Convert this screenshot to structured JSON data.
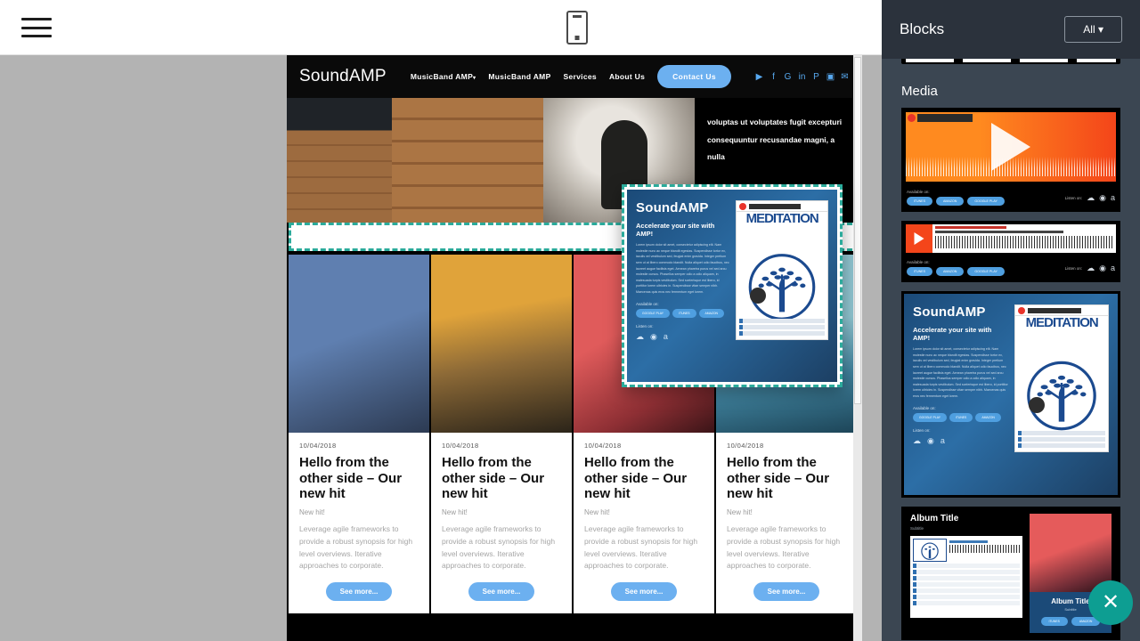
{
  "toolbar": {
    "menu_icon": "hamburger-menu-icon",
    "device_icon": "mobile-preview-icon"
  },
  "site": {
    "brand": "SoundAMP",
    "nav": [
      {
        "label": "MusicBand AMP",
        "has_caret": true
      },
      {
        "label": "MusicBand AMP",
        "has_caret": false
      },
      {
        "label": "Services",
        "has_caret": false
      },
      {
        "label": "About Us",
        "has_caret": false
      }
    ],
    "contact_label": "Contact Us",
    "socials": [
      {
        "name": "youtube-icon",
        "glyph": "▶"
      },
      {
        "name": "facebook-icon",
        "glyph": "f"
      },
      {
        "name": "google-plus-icon",
        "glyph": "G"
      },
      {
        "name": "linkedin-icon",
        "glyph": "in"
      },
      {
        "name": "pinterest-icon",
        "glyph": "P"
      },
      {
        "name": "instagram-icon",
        "glyph": "▣"
      },
      {
        "name": "twitter-icon",
        "glyph": "✉"
      }
    ],
    "hero_lines": [
      "voluptas ut voluptates fugit excepturi",
      "consequuntur recusandae magni, a nulla"
    ]
  },
  "cards": [
    {
      "date": "10/04/2018",
      "title": "Hello from the other side – Our new hit",
      "subtitle": "New hit!",
      "text": "Leverage agile frameworks to provide a robust synopsis for high level overviews. Iterative approaches to corporate.",
      "cta": "See more..."
    },
    {
      "date": "10/04/2018",
      "title": "Hello from the other side – Our new hit",
      "subtitle": "New hit!",
      "text": "Leverage agile frameworks to provide a robust synopsis for high level overviews. Iterative approaches to corporate.",
      "cta": "See more..."
    },
    {
      "date": "10/04/2018",
      "title": "Hello from the other side – Our new hit",
      "subtitle": "New hit!",
      "text": "Leverage agile frameworks to provide a robust synopsis for high level overviews. Iterative approaches to corporate.",
      "cta": "See more..."
    },
    {
      "date": "10/04/2018",
      "title": "Hello from the other side – Our new hit",
      "subtitle": "New hit!",
      "text": "Leverage agile frameworks to provide a robust synopsis for high level overviews. Iterative approaches to corporate.",
      "cta": "See more..."
    }
  ],
  "drag_ghost": {
    "title": "SoundAMP",
    "subtitle": "Accelerate your site with AMP!",
    "body": "Lorem ipsum dolor sit amet, consectetur adipiscing elit. Nam molestie nunc ac neque blandit egestas. Suspendisse tortor ex, iaculis vel vestibulum sed, feugiat enim gravida. Integer pretium sem ut at libero commodo blandit. Nulla aliquet odio faucibus, nec laoreet augue facilisis eget. Aenean pharetra purus vel sed arcu molestie cursus. Phasellus semper odio a odio aliquam, in malesuada turpis vestibulum. Sed scelerisque est libero, id porttitor lorem ultricies in. Suspendisse vitae semper nibh. Maecenas quis eros nec fermentum eget lorem.",
    "available_label": "Available on:",
    "available": [
      "GOOGLE PLAY",
      "ITUNES",
      "AMAZON"
    ],
    "listen_label": "Listen on:",
    "album_word": "MEDITATION",
    "listen_icons": [
      "soundcloud-icon",
      "spotify-icon",
      "amazon-icon"
    ]
  },
  "panel": {
    "title": "Blocks",
    "filter_label": "All",
    "filter_caret": "▾",
    "groups": [
      {
        "label": "Media"
      }
    ],
    "media": {
      "video_block": {
        "available_label": "Available on:",
        "pills": [
          "iTUNES",
          "AMAZON",
          "GOOGLE PLAY"
        ],
        "listen_label": "Listen on:"
      },
      "audio_block": {
        "available_label": "Available on:",
        "pills": [
          "iTUNES",
          "AMAZON",
          "GOOGLE PLAY"
        ],
        "listen_label": "Listen on:"
      },
      "promo_block": {
        "title": "SoundAMP",
        "subtitle": "Accelerate your site with AMP!",
        "available_label": "Available on:",
        "pills": [
          "GOOGLE PLAY",
          "iTUNES",
          "AMAZON"
        ],
        "listen_label": "Listen on:",
        "album_word": "MEDITATION"
      },
      "album_block": {
        "title": "Album Title",
        "subtitle": "Subtitle",
        "card_title": "Album Title",
        "card_subtitle": "Subtitle",
        "pills": [
          "iTUNES",
          "AMAZON"
        ]
      }
    },
    "close_label": "✕"
  }
}
